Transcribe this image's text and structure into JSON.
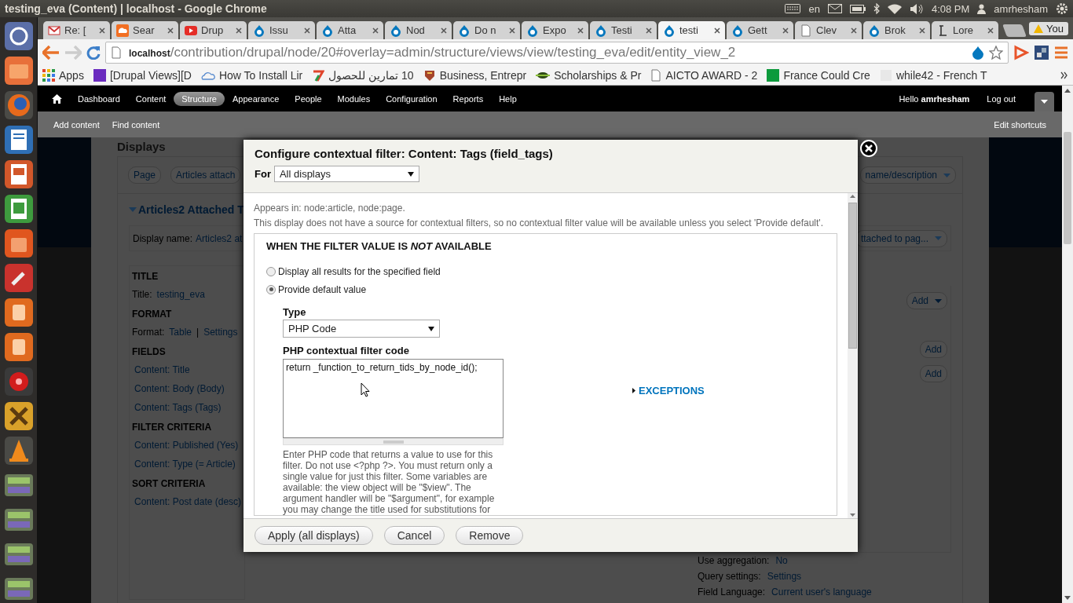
{
  "os_bar": {
    "title": "testing_eva (Content) | localhost - Google Chrome",
    "keyboard_layout": "en",
    "time": "4:08 PM",
    "user": "amrhesham"
  },
  "launcher": [
    {
      "kind": "dash"
    },
    {
      "kind": "folder"
    },
    {
      "kind": "globe"
    },
    {
      "kind": "doc"
    },
    {
      "kind": "slides"
    },
    {
      "kind": "sheet"
    },
    {
      "kind": "bag"
    },
    {
      "kind": "wrench"
    },
    {
      "kind": "box"
    },
    {
      "kind": "box"
    },
    {
      "kind": "record"
    },
    {
      "kind": "cross"
    },
    {
      "kind": "cone"
    },
    {
      "kind": "stack"
    },
    {
      "kind": "stack"
    },
    {
      "kind": "stack"
    },
    {
      "kind": "stack"
    }
  ],
  "browser": {
    "tabs": [
      {
        "title": "Re: [",
        "kind": "mail",
        "selected": false
      },
      {
        "title": "Sear",
        "kind": "cloud",
        "selected": false
      },
      {
        "title": "Drup",
        "kind": "play",
        "selected": false
      },
      {
        "title": "Issu",
        "kind": "drop",
        "selected": false
      },
      {
        "title": "Atta",
        "kind": "drop",
        "selected": false
      },
      {
        "title": "Nod",
        "kind": "drop",
        "selected": false
      },
      {
        "title": "Do n",
        "kind": "drop",
        "selected": false
      },
      {
        "title": "Expo",
        "kind": "drop",
        "selected": false
      },
      {
        "title": "Testi",
        "kind": "drop",
        "selected": false
      },
      {
        "title": "testi",
        "kind": "drop",
        "selected": true
      },
      {
        "title": "Gett",
        "kind": "drop",
        "selected": false
      },
      {
        "title": "Clev",
        "kind": "page",
        "selected": false
      },
      {
        "title": "Brok",
        "kind": "drop",
        "selected": false
      },
      {
        "title": "Lore",
        "kind": "serif",
        "selected": false
      }
    ],
    "profile": "You",
    "url_host": "localhost",
    "url_path": "/contribution/drupal/node/20#overlay=admin/structure/views/view/testing_eva/edit/entity_view_2",
    "bookmarks": [
      {
        "label": "Apps",
        "kind": "grid"
      },
      {
        "label": "[Drupal Views][D",
        "kind": "square",
        "color": "#6a2bbf"
      },
      {
        "label": "How To Install Lir",
        "kind": "cloud"
      },
      {
        "label": "10 تمارين للحصول",
        "kind": "swoosh"
      },
      {
        "label": "Business, Entrepr",
        "kind": "shield"
      },
      {
        "label": "Scholarships & Pr",
        "kind": "bug"
      },
      {
        "label": "AICTO AWARD - 2",
        "kind": "page"
      },
      {
        "label": "France Could Cre",
        "kind": "square",
        "color": "#0c9a3c"
      },
      {
        "label": "while42 - French T",
        "kind": "faded"
      }
    ]
  },
  "toolbar": {
    "menu": [
      {
        "label": "Dashboard",
        "selected": false
      },
      {
        "label": "Content",
        "selected": false
      },
      {
        "label": "Structure",
        "selected": true
      },
      {
        "label": "Appearance",
        "selected": false
      },
      {
        "label": "People",
        "selected": false
      },
      {
        "label": "Modules",
        "selected": false
      },
      {
        "label": "Configuration",
        "selected": false
      },
      {
        "label": "Reports",
        "selected": false
      },
      {
        "label": "Help",
        "selected": false
      }
    ],
    "greeting": "Hello **amrhesham**",
    "logout": "Log out",
    "shortcuts": [
      "Add content",
      "Find content"
    ],
    "edit_shortcuts": "Edit shortcuts"
  },
  "views": {
    "heading": "Displays",
    "display_tabs": [
      "Page",
      "Articles attach"
    ],
    "display_menu": "name/description",
    "section_title": "Articles2 Attached T",
    "display_name_label": "Display name:",
    "display_name": "Articles2 at",
    "display_name_menu": "ttached to pag...",
    "sections": [
      {
        "title": "TITLE",
        "rows": [
          {
            "label": "Title:",
            "value": "testing_eva"
          }
        ]
      },
      {
        "title": "FORMAT",
        "rows": [
          {
            "label": "Format:",
            "value": "Table",
            "separator": "|",
            "extra": "Settings"
          }
        ]
      },
      {
        "title": "FIELDS",
        "rows": [
          {
            "value": "Content: Title"
          },
          {
            "value": "Content: Body (Body)"
          },
          {
            "value": "Content: Tags (Tags)"
          }
        ]
      },
      {
        "title": "FILTER CRITERIA",
        "rows": [
          {
            "value": "Content: Published (Yes)"
          },
          {
            "value": "Content: Type (= Article)"
          }
        ]
      },
      {
        "title": "SORT CRITERIA",
        "rows": [
          {
            "value": "Content: Post date (desc)"
          }
        ]
      }
    ],
    "add_buttons": [
      {
        "label": "Add",
        "menu": true
      },
      {
        "label": "Add",
        "menu": false
      },
      {
        "label": "Add",
        "menu": false
      }
    ],
    "settings": [
      {
        "label": "Use aggregation:",
        "value": "No"
      },
      {
        "label": "Query settings:",
        "value": "Settings"
      },
      {
        "label": "Field Language:",
        "value": "Current user's language"
      }
    ]
  },
  "dialog": {
    "title": "Configure contextual filter: Content: Tags (field_tags)",
    "for_label": "For",
    "for_value": "All displays",
    "appears_in": "Appears in: node:article, node:page.",
    "note": "This display does not have a source for contextual filters, so no contextual filter value will be available unless you select 'Provide default'.",
    "legend": "WHEN THE FILTER VALUE IS *NOT* AVAILABLE",
    "options": [
      {
        "label": "Display all results for the specified field",
        "selected": false
      },
      {
        "label": "Provide default value",
        "selected": true
      }
    ],
    "exceptions": "EXCEPTIONS",
    "type_label": "Type",
    "type_value": "PHP Code",
    "code_label": "PHP contextual filter code",
    "code": "return _function_to_return_tids_by_node_id();",
    "help": "Enter PHP code that returns a value to use for this filter. Do not use <?php ?>. You must return only a single value for just this filter. Some variables are available: the view object will be \"$view\". The argument handler will be \"$argument\", for example you may change the title used for substitutions for",
    "buttons": [
      "Apply (all displays)",
      "Cancel",
      "Remove"
    ]
  }
}
